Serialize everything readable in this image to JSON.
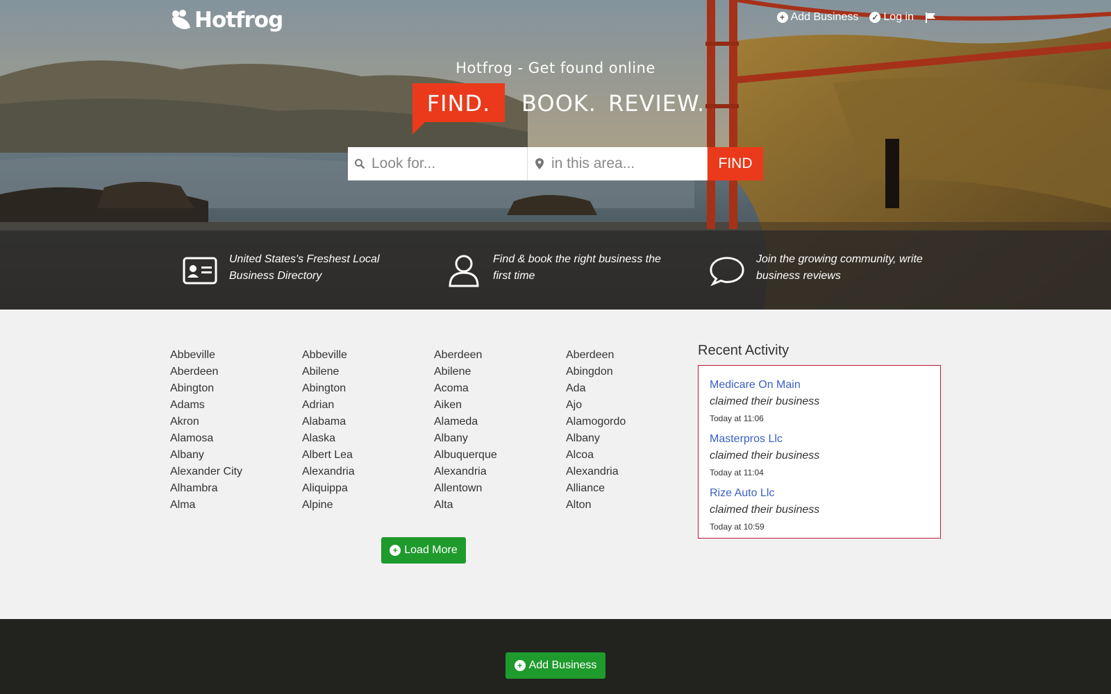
{
  "header": {
    "logo_text": "Hotfrog",
    "nav": {
      "add_business": "Add Business",
      "log_in": "Log in"
    }
  },
  "hero": {
    "tagline": "Hotfrog - Get found online",
    "words": [
      "FIND.",
      "BOOK.",
      "REVIEW."
    ],
    "search": {
      "what_placeholder": "Look for...",
      "where_placeholder": "in this area...",
      "button": "FIND"
    },
    "accent_color": "#ea3a1b"
  },
  "features": [
    {
      "icon": "id-card-icon",
      "text": "United States's Freshest Local Business Directory"
    },
    {
      "icon": "user-icon",
      "text": "Find & book the right business the first time"
    },
    {
      "icon": "speech-bubble-icon",
      "text": "Join the growing community, write business reviews"
    }
  ],
  "cities": {
    "columns": [
      [
        "Abbeville",
        "Aberdeen",
        "Abington",
        "Adams",
        "Akron",
        "Alamosa",
        "Albany",
        "Alexander City",
        "Alhambra",
        "Alma"
      ],
      [
        "Abbeville",
        "Abilene",
        "Abington",
        "Adrian",
        "Alabama",
        "Alaska",
        "Albert Lea",
        "Alexandria",
        "Aliquippa",
        "Alpine"
      ],
      [
        "Aberdeen",
        "Abilene",
        "Acoma",
        "Aiken",
        "Alameda",
        "Albany",
        "Albuquerque",
        "Alexandria",
        "Allentown",
        "Alta"
      ],
      [
        "Aberdeen",
        "Abingdon",
        "Ada",
        "Ajo",
        "Alamogordo",
        "Albany",
        "Alcoa",
        "Alexandria",
        "Alliance",
        "Alton"
      ]
    ],
    "load_more": "Load More"
  },
  "recent_activity": {
    "title": "Recent Activity",
    "items": [
      {
        "name": "Medicare On Main",
        "action": "claimed their business",
        "time": "Today at 11:06"
      },
      {
        "name": "Masterpros Llc",
        "action": "claimed their business",
        "time": "Today at 11:04"
      },
      {
        "name": "Rize Auto Llc",
        "action": "claimed their business",
        "time": "Today at 10:59"
      }
    ],
    "border_color": "#c0163b",
    "link_color": "#3a60c4"
  },
  "footer": {
    "add_business": "Add Business",
    "button_color": "#1f9a2c"
  }
}
